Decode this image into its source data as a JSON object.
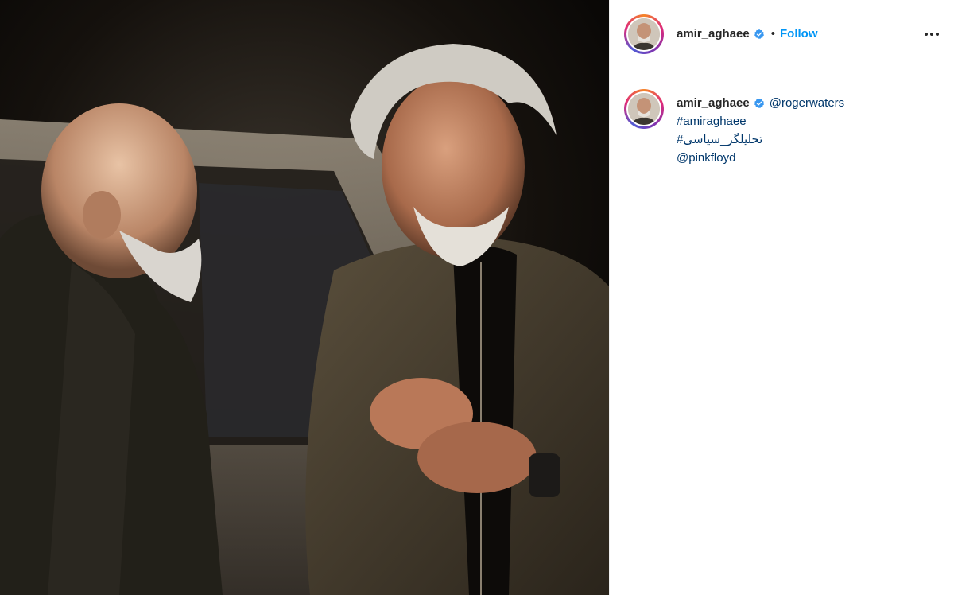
{
  "post": {
    "username": "amir_aghaee",
    "separator": "•",
    "follow_label": "Follow",
    "more_icon": "more-horizontal-icon",
    "verified_icon": "verified-badge-icon"
  },
  "caption": {
    "username": "amir_aghaee",
    "mention_1": "@rogerwaters",
    "hashtag_1": "#amiraghaee",
    "hashtag_2": "تحلیلگر_سیاسی#",
    "mention_2": "@pinkfloyd"
  },
  "colors": {
    "link": "#0095f6",
    "caption_link": "#00376b",
    "text": "#262626"
  }
}
